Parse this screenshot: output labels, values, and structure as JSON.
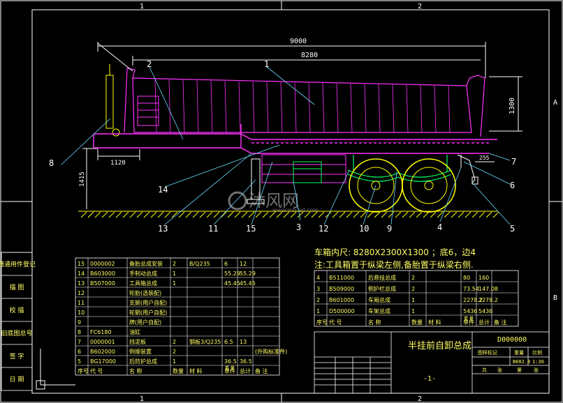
{
  "drawing": {
    "background_color": "#000000",
    "frame_color": "#ffffff",
    "body_color": "#ff33ff",
    "wheel_color": "#ffff00",
    "chassis_color": "#00ff66",
    "dimension_color": "#ffffff",
    "text_color": "#ffff66",
    "leader_color": "#66ddff",
    "zone_labels": [
      "1",
      "2",
      "A",
      "B"
    ],
    "dimensions": {
      "overall_length": "9000",
      "box_length": "8280",
      "box_height": "1300",
      "front_overhang": "1120",
      "ground_height": "1415",
      "rear_offset": "255"
    },
    "callouts": [
      "1",
      "2",
      "3",
      "4",
      "5",
      "6",
      "7",
      "8",
      "9",
      "10",
      "11",
      "12",
      "13",
      "14",
      "15"
    ],
    "watermark": "沐风网",
    "watermark_sub": "www.mfcad.com"
  },
  "notes": {
    "line1": "车箱内尺: 8280X2300X1300 ；底6，边4",
    "line2": "注:工具箱置于纵梁左侧,备胎置于纵梁右侧."
  },
  "left_title_column": [
    "借通用件登记",
    "描 图",
    "校 描",
    "旧底图总号",
    "签 字",
    "日 期"
  ],
  "bom_left": {
    "header": [
      "序号",
      "代 号",
      "名 称",
      "数量",
      "材 料",
      "单件",
      "总计",
      "备 注"
    ],
    "header_sub": "重 量",
    "rows": [
      [
        "15",
        "0000002",
        "备胎总成安装",
        "2",
        "B/Q235",
        "6",
        "12",
        ""
      ],
      [
        "14",
        "B603000",
        "手制动总成",
        "1",
        "",
        "55.29",
        "55.29",
        ""
      ],
      [
        "13",
        "B507000",
        "工具箱总成",
        "1",
        "",
        "45.45",
        "45.45",
        ""
      ],
      [
        "12",
        "",
        "轮胎(选装配)",
        "",
        "",
        "",
        "",
        ""
      ],
      [
        "11",
        "",
        "支腿(用户自配)",
        "",
        "",
        "",
        "",
        ""
      ],
      [
        "10",
        "",
        "轮辋(用户自配)",
        "",
        "",
        "",
        "",
        ""
      ],
      [
        "9",
        "",
        "牌(用户自配)",
        "",
        "",
        "",
        "",
        ""
      ],
      [
        "8",
        "FC6180",
        "油缸",
        "",
        "",
        "",
        "",
        ""
      ],
      [
        "7",
        "0000001",
        "挡泥板",
        "2",
        "钢板3/Q235",
        "6.5",
        "13",
        ""
      ],
      [
        "6",
        "B602000",
        "倒顺装置",
        "2",
        "",
        "",
        "",
        "(外购标准件)"
      ],
      [
        "5",
        "BG17000",
        "后防护总成",
        "1",
        "",
        "36.5",
        "36.5",
        ""
      ]
    ]
  },
  "bom_right": {
    "header": [
      "序号",
      "代 号",
      "名 称",
      "数量",
      "材 料",
      "单件",
      "总计",
      "备 注"
    ],
    "header_sub": "重 量",
    "rows": [
      [
        "4",
        "B511000",
        "后悬挂总成",
        "2",
        "",
        "80",
        "160",
        ""
      ],
      [
        "3",
        "B509000",
        "侧护栏总成",
        "2",
        "",
        "73.54",
        "147.08",
        ""
      ],
      [
        "2",
        "B601000",
        "车厢总成",
        "1",
        "",
        "2278.2",
        "2278.2",
        ""
      ],
      [
        "1",
        "D500000",
        "车架总成",
        "1",
        "",
        "5436",
        "5436",
        ""
      ]
    ]
  },
  "title_block": {
    "drawing_name": "半挂前自卸总成",
    "drawing_no": "D000000",
    "sheet": "-1-",
    "cells": [
      "图样标记",
      "重量",
      "比例",
      "B602.8",
      "1:30",
      "共",
      "张",
      "第",
      "张"
    ]
  }
}
